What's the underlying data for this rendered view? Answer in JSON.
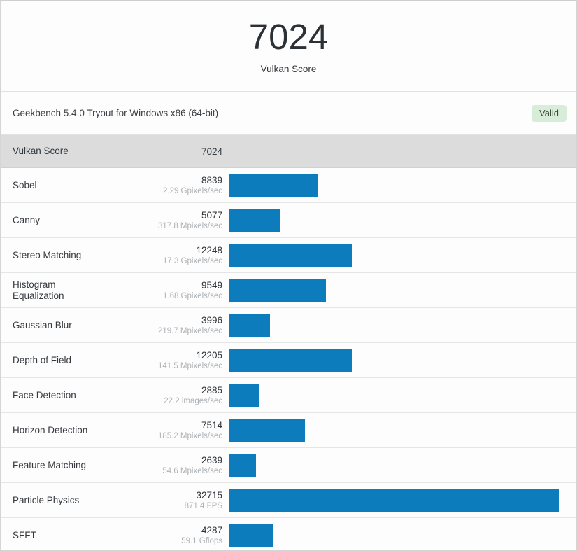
{
  "hero": {
    "score": "7024",
    "label": "Vulkan Score"
  },
  "info": {
    "build_text": "Geekbench 5.4.0 Tryout for Windows x86 (64-bit)",
    "badge": "Valid"
  },
  "table": {
    "header": {
      "name": "Vulkan Score",
      "score": "7024"
    }
  },
  "colors": {
    "bar": "#0c7cbd",
    "header_band": "#dcdcdc",
    "badge_bg": "#d8edd9",
    "card_border": "#d5d5d5"
  },
  "chart_data": {
    "type": "bar",
    "title": "Vulkan Score",
    "xlabel": "",
    "ylabel": "",
    "orientation": "horizontal",
    "max_value": 32715,
    "overall_score": 7024,
    "categories": [
      "Sobel",
      "Canny",
      "Stereo Matching",
      "Histogram Equalization",
      "Gaussian Blur",
      "Depth of Field",
      "Face Detection",
      "Horizon Detection",
      "Feature Matching",
      "Particle Physics",
      "SFFT"
    ],
    "values": [
      8839,
      5077,
      12248,
      9549,
      3996,
      12205,
      2885,
      7514,
      2639,
      32715,
      4287
    ],
    "rates": [
      "2.29 Gpixels/sec",
      "317.8 Mpixels/sec",
      "17.3 Gpixels/sec",
      "1.68 Gpixels/sec",
      "219.7 Mpixels/sec",
      "141.5 Mpixels/sec",
      "22.2 images/sec",
      "185.2 Mpixels/sec",
      "54.6 Mpixels/sec",
      "871.4 FPS",
      "59.1 Gflops"
    ],
    "rows": [
      {
        "name": "Sobel",
        "name_lines": [
          "Sobel"
        ],
        "score": 8839,
        "score_text": "8839",
        "rate": "2.29 Gpixels/sec"
      },
      {
        "name": "Canny",
        "name_lines": [
          "Canny"
        ],
        "score": 5077,
        "score_text": "5077",
        "rate": "317.8 Mpixels/sec"
      },
      {
        "name": "Stereo Matching",
        "name_lines": [
          "Stereo Matching"
        ],
        "score": 12248,
        "score_text": "12248",
        "rate": "17.3 Gpixels/sec"
      },
      {
        "name": "Histogram Equalization",
        "name_lines": [
          "Histogram",
          "Equalization"
        ],
        "score": 9549,
        "score_text": "9549",
        "rate": "1.68 Gpixels/sec"
      },
      {
        "name": "Gaussian Blur",
        "name_lines": [
          "Gaussian Blur"
        ],
        "score": 3996,
        "score_text": "3996",
        "rate": "219.7 Mpixels/sec"
      },
      {
        "name": "Depth of Field",
        "name_lines": [
          "Depth of Field"
        ],
        "score": 12205,
        "score_text": "12205",
        "rate": "141.5 Mpixels/sec"
      },
      {
        "name": "Face Detection",
        "name_lines": [
          "Face Detection"
        ],
        "score": 2885,
        "score_text": "2885",
        "rate": "22.2 images/sec"
      },
      {
        "name": "Horizon Detection",
        "name_lines": [
          "Horizon Detection"
        ],
        "score": 7514,
        "score_text": "7514",
        "rate": "185.2 Mpixels/sec"
      },
      {
        "name": "Feature Matching",
        "name_lines": [
          "Feature Matching"
        ],
        "score": 2639,
        "score_text": "2639",
        "rate": "54.6 Mpixels/sec"
      },
      {
        "name": "Particle Physics",
        "name_lines": [
          "Particle Physics"
        ],
        "score": 32715,
        "score_text": "32715",
        "rate": "871.4 FPS"
      },
      {
        "name": "SFFT",
        "name_lines": [
          "SFFT"
        ],
        "score": 4287,
        "score_text": "4287",
        "rate": "59.1 Gflops"
      }
    ]
  }
}
